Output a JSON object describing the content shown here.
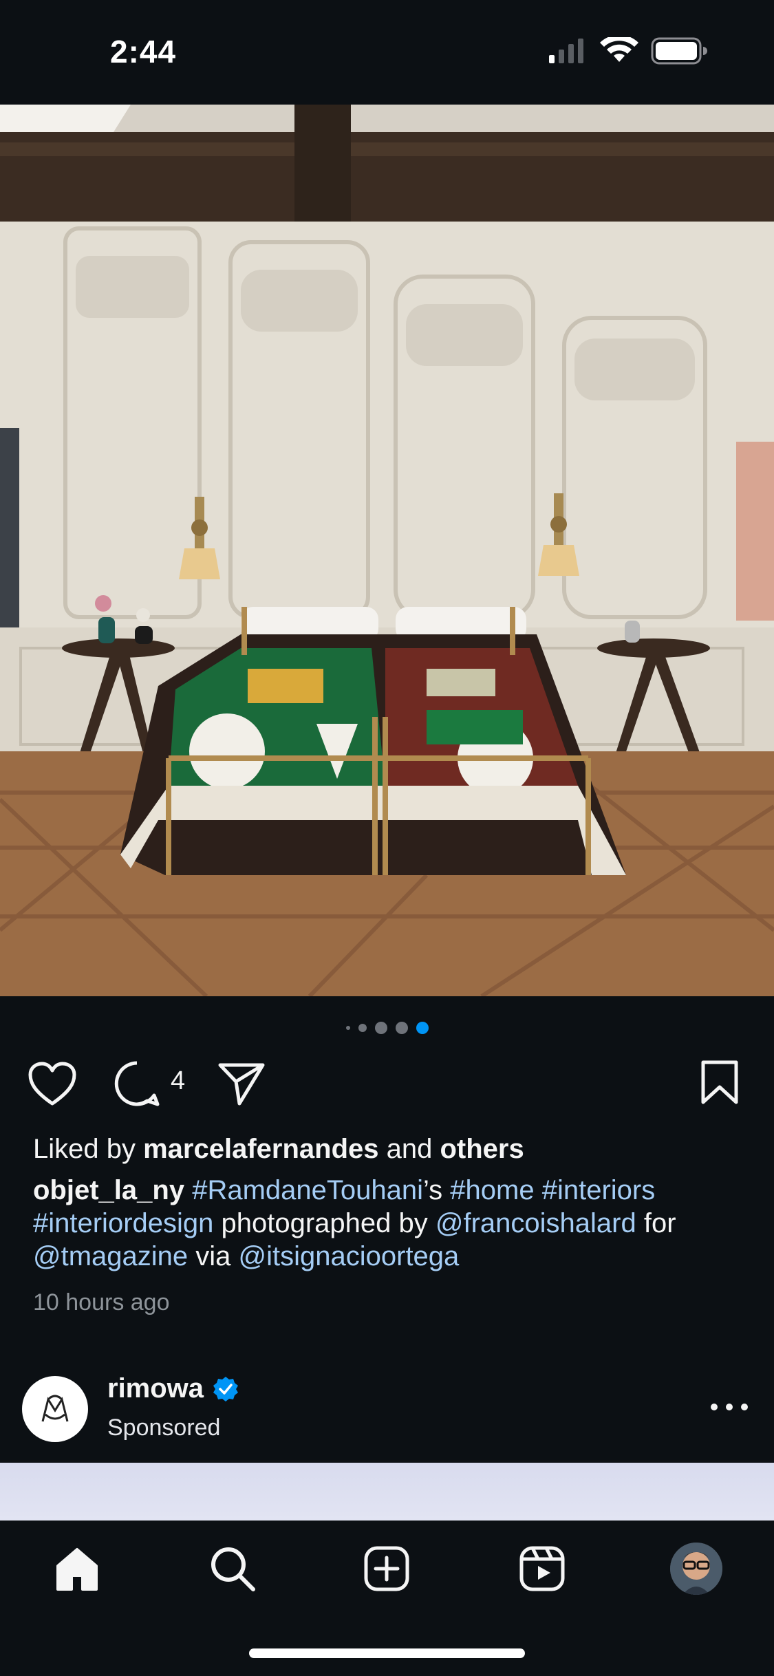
{
  "status_bar": {
    "time": "2:44",
    "icons": [
      "cellular-signal-icon",
      "wifi-icon",
      "battery-icon"
    ]
  },
  "post": {
    "image_description_icon": "bedroom-photo",
    "carousel": {
      "total_dots": 5,
      "active_index": 4
    },
    "actions": {
      "comment_count": "4"
    },
    "likes": {
      "prefix": "Liked by ",
      "user": "marcelafernandes",
      "middle": " and ",
      "others": "others"
    },
    "caption": {
      "username": "objet_la_ny",
      "tag1": "#RamdaneTouhani",
      "text1": "’s ",
      "tag2": "#home",
      "tag3": "#interiors",
      "tag4": "#interiordesign",
      "text2": " photographed by ",
      "mention1": "@francoishalard",
      "text3": " for ",
      "mention2": "@tmagazine",
      "text4": " via ",
      "mention3": "@itsignacioortega"
    },
    "time_ago": "10 hours ago"
  },
  "sponsored": {
    "name": "rimowa",
    "label": "Sponsored",
    "verified": true
  },
  "colors": {
    "background": "#0c1014",
    "link": "#a5cdf5",
    "active_dot": "#0095f6",
    "verified_badge": "#0095f6"
  },
  "bottom_nav": {
    "items": [
      "home-icon",
      "search-icon",
      "create-icon",
      "reels-icon",
      "profile-avatar"
    ],
    "active": "home-icon"
  }
}
